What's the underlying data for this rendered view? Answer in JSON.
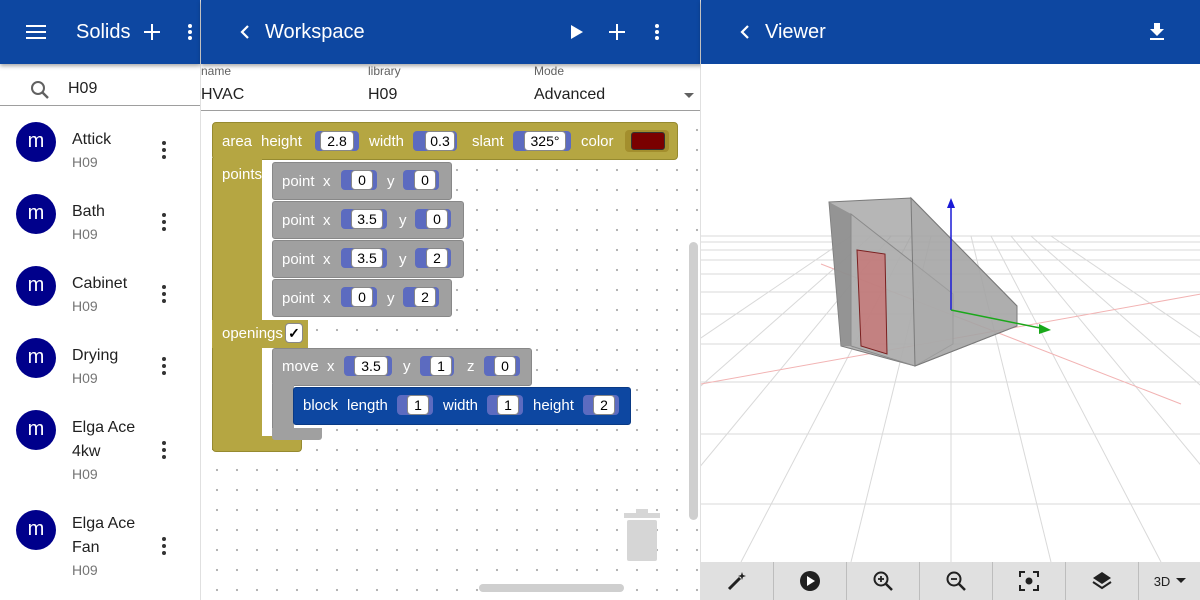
{
  "colors": {
    "app_bar": "#0d47a1",
    "avatar": "#00008b",
    "area_block": "#b5a642",
    "point_block": "#a0a0a0",
    "number_slot": "#5c6bc0",
    "block_block": "#0d47a1",
    "color_swatch": "#7a0000"
  },
  "solids": {
    "title": "Solids",
    "search": {
      "value": "H09"
    },
    "items": [
      {
        "name": "Attick",
        "library": "H09",
        "avatar": "m"
      },
      {
        "name": "Bath",
        "library": "H09",
        "avatar": "m"
      },
      {
        "name": "Cabinet",
        "library": "H09",
        "avatar": "m"
      },
      {
        "name": "Drying",
        "library": "H09",
        "avatar": "m"
      },
      {
        "name": "Elga Ace 4kw",
        "library": "H09",
        "avatar": "m"
      },
      {
        "name": "Elga Ace Fan",
        "library": "H09",
        "avatar": "m"
      }
    ]
  },
  "workspace": {
    "title": "Workspace",
    "fields": {
      "name_label": "name",
      "name_value": "HVAC",
      "library_label": "library",
      "library_value": "H09",
      "mode_label": "Mode",
      "mode_value": "Advanced"
    },
    "blocks": {
      "area": {
        "label": "area",
        "height_label": "height",
        "height": "2.8",
        "width_label": "width",
        "width": "0.3",
        "slant_label": "slant",
        "slant": "325°",
        "color_label": "color",
        "points_label": "points",
        "openings_label": "openings",
        "openings_checked": "✓"
      },
      "points": [
        {
          "label": "point",
          "x_label": "x",
          "x": "0",
          "y_label": "y",
          "y": "0"
        },
        {
          "label": "point",
          "x_label": "x",
          "x": "3.5",
          "y_label": "y",
          "y": "0"
        },
        {
          "label": "point",
          "x_label": "x",
          "x": "3.5",
          "y_label": "y",
          "y": "2"
        },
        {
          "label": "point",
          "x_label": "x",
          "x": "0",
          "y_label": "y",
          "y": "2"
        }
      ],
      "move": {
        "label": "move",
        "x_label": "x",
        "x": "3.5",
        "y_label": "y",
        "y": "1",
        "z_label": "z",
        "z": "0"
      },
      "block": {
        "label": "block",
        "length_label": "length",
        "length": "1",
        "width_label": "width",
        "width": "1",
        "height_label": "height",
        "height": "2"
      }
    }
  },
  "viewer": {
    "title": "Viewer",
    "view_mode": "3D"
  }
}
